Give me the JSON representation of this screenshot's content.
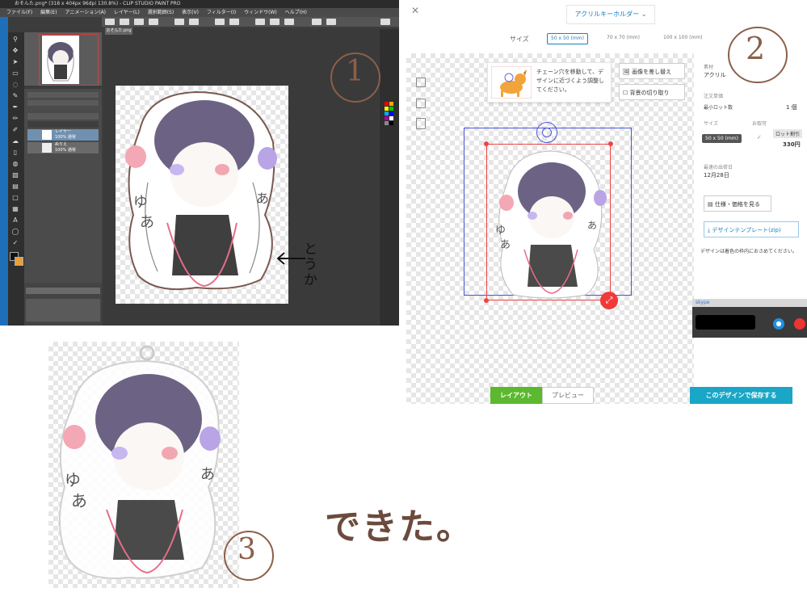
{
  "annotations": {
    "step1": "1",
    "step2": "2",
    "step3": "3",
    "dekita": "できた。"
  },
  "csp": {
    "title": "おそんた.png* (318 x 404px 96dpi 130.8%) - CLIP STUDIO PAINT PRO",
    "menu": [
      "ファイル(F)",
      "編集(E)",
      "アニメーション(A)",
      "レイヤー(L)",
      "選択範囲(S)",
      "表示(V)",
      "フィルター(I)",
      "ウィンドウ(W)",
      "ヘルプ(H)"
    ],
    "tab": "おそんた.png",
    "layers": [
      {
        "name": "レイヤー",
        "detail": "100% 通常"
      },
      {
        "name": "ぬりえ",
        "detail": "100% 通常"
      }
    ],
    "hand_note": "とうか"
  },
  "web": {
    "product": "アクリルキーホルダー",
    "size_label": "サイズ",
    "sizes": [
      "50 x 50 (mm)",
      "70 x 70 (mm)",
      "100 x 100 (mm)"
    ],
    "tip": "チェーン穴を移動して、デザインに近づくよう調整してください。",
    "replace_image": "画像を差し替え",
    "bg_cut": "背景の切り取り",
    "material_label": "素材",
    "material": "アクリル",
    "order_label": "注文単価",
    "min_lot_label": "最小ロット数",
    "min_lot": "1 個",
    "size_head": "サイズ",
    "order_possible": "お取可",
    "lot_discount": "ロット割引",
    "size_value": "50 x 50 (mm)",
    "price": "330円",
    "ship_label": "最速の出荷日",
    "ship_date": "12月28日",
    "spec_btn": "仕様・価格を見る",
    "template_btn": "デザインテンプレート(zip)",
    "note": "デザインは着色の枠内におさめてください。",
    "tab_layout": "レイアウト",
    "tab_preview": "プレビュー",
    "save": "このデザインで保存する",
    "skype": "skype"
  }
}
